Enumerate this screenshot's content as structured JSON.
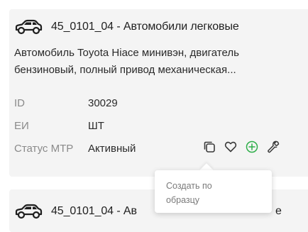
{
  "card1": {
    "title": "45_0101_04 - Автомобили легковые",
    "description_line1": "Автомобиль Toyota Hiace минивэн, двигатель",
    "description_line2": "бензиновый, полный привод механическая...",
    "fields": [
      {
        "label": "ID",
        "value": "30029"
      },
      {
        "label": "ЕИ",
        "value": "ШТ"
      },
      {
        "label": "Статус МТР",
        "value": "Активный"
      }
    ],
    "icons": [
      "car-icon",
      "copy-icon",
      "heart-icon",
      "plus-circle-icon",
      "wrench-icon"
    ]
  },
  "tooltip": {
    "line1": "Создать по",
    "line2": "образцу"
  },
  "card2": {
    "title_left": "45_0101_04 - Ав",
    "title_right": "е"
  },
  "colors": {
    "card_bg": "#f4f4f4",
    "accent_green": "#2fae4a",
    "label_gray": "#8a8a8a"
  }
}
